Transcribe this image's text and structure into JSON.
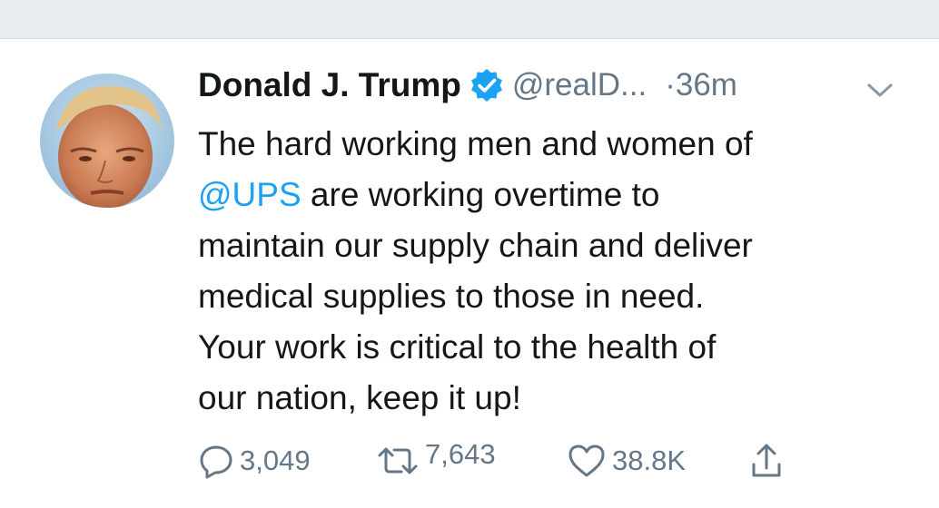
{
  "tweet": {
    "author_name": "Donald J. Trump",
    "handle": "@realD...",
    "time": "·36m",
    "text_line1": "The hard working men and women of",
    "mention": "@UPS",
    "text_line2_rest": " are working overtime to",
    "text_line3": "maintain our supply chain and deliver",
    "text_line4": "medical supplies to those in need.",
    "text_line5": "Your work is critical to the health of",
    "text_line6": "our nation, keep it up!"
  },
  "actions": {
    "replies": "3,049",
    "retweets": "7,643",
    "likes": "38.8K"
  },
  "colors": {
    "accent": "#1da1f2",
    "text": "#14171a",
    "muted": "#657786",
    "topbar": "#e6ecf0"
  },
  "icons": {
    "verified": "verified-badge-icon",
    "caret": "chevron-down-icon",
    "reply": "reply-icon",
    "retweet": "retweet-icon",
    "like": "heart-icon",
    "share": "share-icon"
  }
}
